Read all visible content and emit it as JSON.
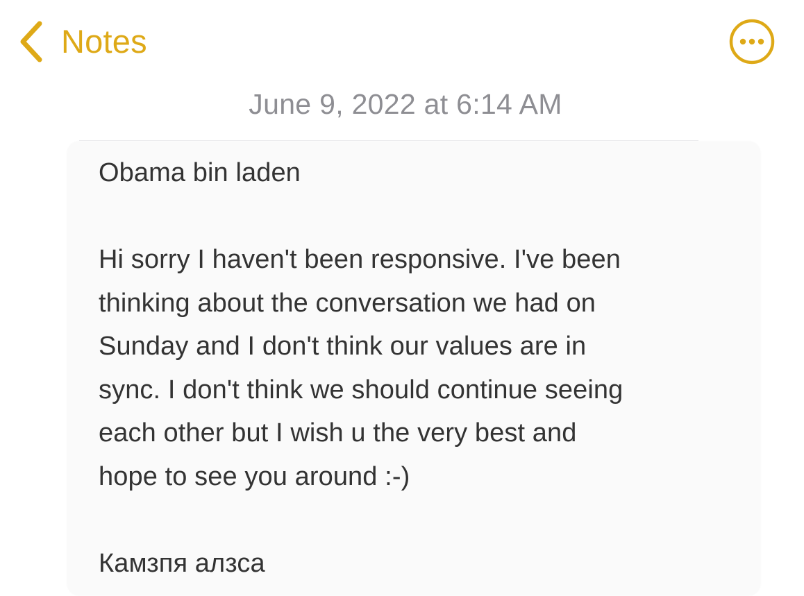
{
  "nav": {
    "back_label": "Notes",
    "back_icon": "chevron-left-icon",
    "more_icon": "ellipsis-circle-icon",
    "accent_color": "#DEA917"
  },
  "note": {
    "timestamp": "June 9, 2022 at 6:14 AM",
    "title": "Obama bin laden",
    "paragraph_lines": [
      "Hi sorry I haven't been responsive. I've been",
      "thinking about the conversation we had on",
      "Sunday and I don't think our values are in",
      "sync. I don't think we should continue seeing",
      "each other but I wish u the very best and",
      "hope to see you around :-)"
    ],
    "signature": "Камзпя алзса"
  }
}
